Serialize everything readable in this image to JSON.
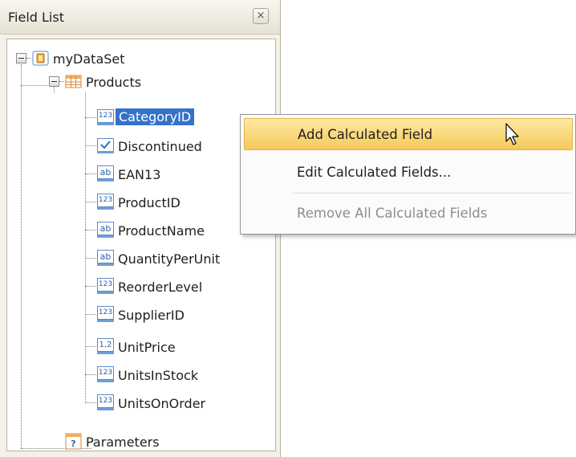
{
  "panel": {
    "title": "Field List",
    "close_glyph": "×"
  },
  "tree": {
    "root": {
      "label": "myDataSet",
      "icon": "dataset-icon"
    },
    "table": {
      "label": "Products",
      "icon": "table-icon"
    },
    "fields": [
      {
        "label": "CategoryID",
        "type": "123",
        "selected": true
      },
      {
        "label": "Discontinued",
        "type": "check"
      },
      {
        "label": "EAN13",
        "type": "ab"
      },
      {
        "label": "ProductID",
        "type": "123"
      },
      {
        "label": "ProductName",
        "type": "ab"
      },
      {
        "label": "QuantityPerUnit",
        "type": "ab"
      },
      {
        "label": "ReorderLevel",
        "type": "123"
      },
      {
        "label": "SupplierID",
        "type": "123"
      },
      {
        "label": "UnitPrice",
        "type": "1,2"
      },
      {
        "label": "UnitsInStock",
        "type": "123"
      },
      {
        "label": "UnitsOnOrder",
        "type": "123"
      }
    ],
    "parameters": {
      "label": "Parameters",
      "icon": "parameters-icon"
    }
  },
  "context_menu": {
    "items": [
      {
        "label": "Add Calculated Field",
        "state": "hovered"
      },
      {
        "label": "Edit Calculated Fields...",
        "state": "normal"
      },
      {
        "label": "Remove All Calculated Fields",
        "state": "disabled"
      }
    ]
  },
  "colors": {
    "selection": "#3472c8",
    "menu_highlight": "#f6c95a",
    "panel_bg": "#f3f1e9"
  }
}
